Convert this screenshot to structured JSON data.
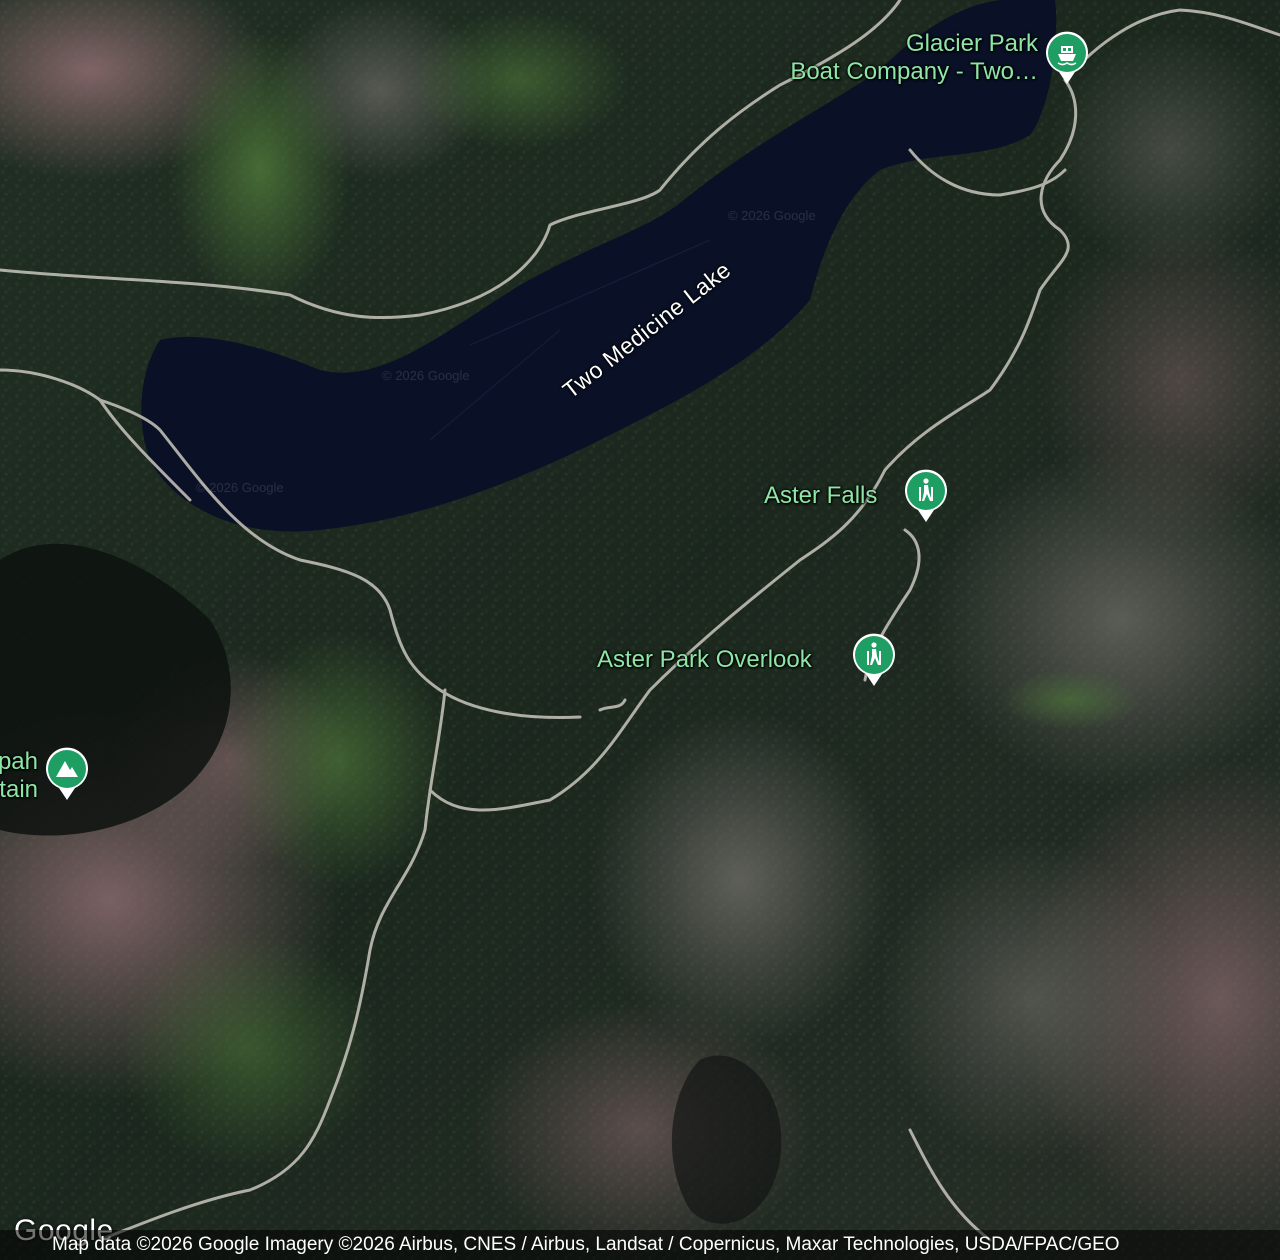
{
  "map": {
    "type": "satellite",
    "water_label": "Two Medicine Lake",
    "places": [
      {
        "id": "glacier-park-boat-company",
        "lines": [
          "Glacier Park",
          "Boat Company -  Two…"
        ],
        "icon": "ferry-icon"
      },
      {
        "id": "aster-falls",
        "lines": [
          "Aster Falls"
        ],
        "icon": "hiker-icon"
      },
      {
        "id": "aster-park-overlook",
        "lines": [
          "Aster Park Overlook"
        ],
        "icon": "hiker-icon"
      },
      {
        "id": "mountain-partial",
        "lines": [
          "pah",
          "tain"
        ],
        "icon": "mountain-icon"
      }
    ],
    "watermark": "© 2026 Google",
    "pin_color": "#1e9e63",
    "label_color": "#8ee6a6"
  },
  "footer": {
    "logo": "Google",
    "attribution": "Map data ©2026 Google Imagery ©2026 Airbus, CNES / Airbus, Landsat / Copernicus, Maxar Technologies, USDA/FPAC/GEO"
  }
}
